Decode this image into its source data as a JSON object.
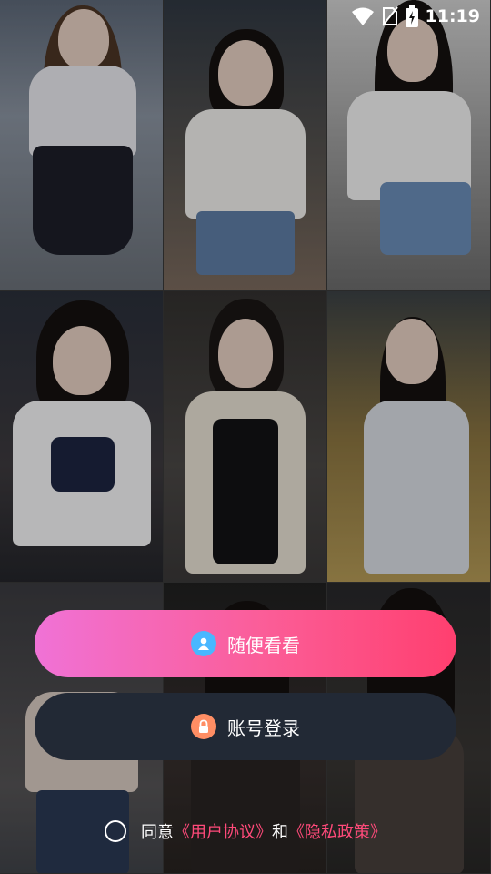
{
  "status_bar": {
    "time": "11:19"
  },
  "buttons": {
    "guest_label": "随便看看",
    "login_label": "账号登录"
  },
  "agreement": {
    "prefix": "同意",
    "user_agreement": "《用户协议》",
    "conjunction": "和",
    "privacy_policy": "《隐私政策》"
  },
  "colors": {
    "guest_gradient": [
      "#f072d6",
      "#ff3f6f"
    ],
    "login_bg": "#222935",
    "link": "#ff4a7a"
  },
  "icons": {
    "guest": "user-icon",
    "login": "lock-icon"
  }
}
